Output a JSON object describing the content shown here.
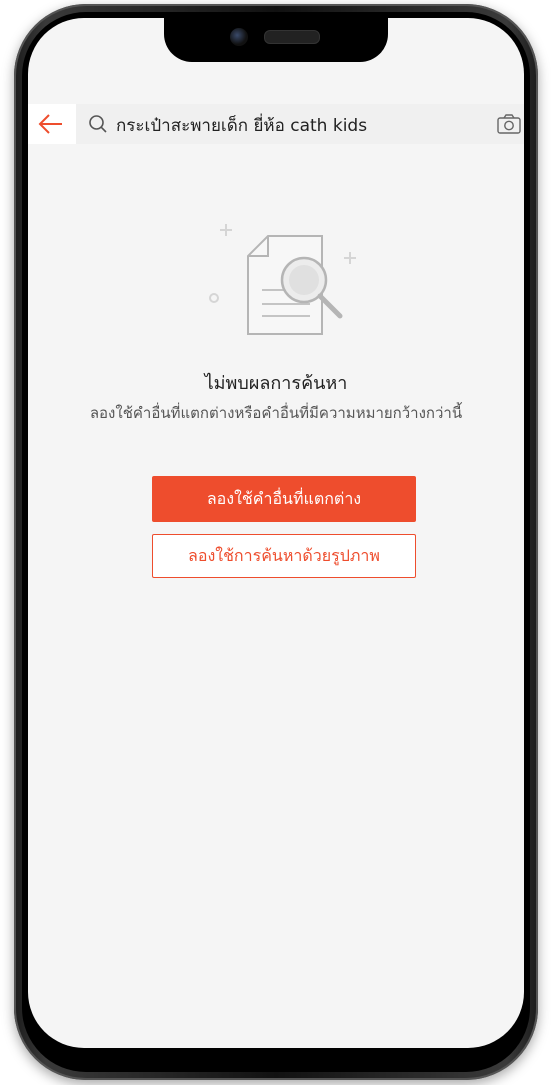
{
  "search": {
    "query": "กระเป๋าสะพายเด็ก ยี่ห้อ cath kids"
  },
  "empty_state": {
    "title": "ไม่พบผลการค้นหา",
    "description": "ลองใช้คำอื่นที่แตกต่างหรือคำอื่นที่มีความหมายกว้างกว่านี้"
  },
  "actions": {
    "primary_label": "ลองใช้คำอื่นที่แตกต่าง",
    "secondary_label": "ลองใช้การค้นหาด้วยรูปภาพ"
  },
  "icons": {
    "back": "arrow-left-icon",
    "search": "search-icon",
    "camera": "camera-icon",
    "empty": "document-search-icon"
  },
  "colors": {
    "accent": "#ee4d2d",
    "background": "#f5f5f5",
    "search_bg": "#f0f0f0"
  }
}
